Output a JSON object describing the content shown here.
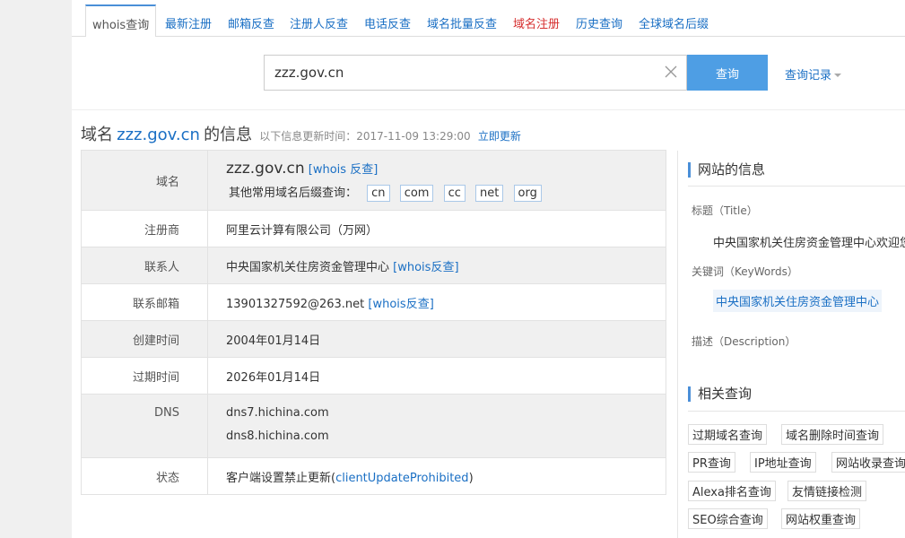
{
  "tabs": [
    {
      "label": "whois查询",
      "active": true
    },
    {
      "label": "最新注册"
    },
    {
      "label": "邮箱反查"
    },
    {
      "label": "注册人反查"
    },
    {
      "label": "电话反查"
    },
    {
      "label": "域名批量反查"
    },
    {
      "label": "域名注册",
      "color": "#d62f2f"
    },
    {
      "label": "历史查询"
    },
    {
      "label": "全球域名后缀"
    }
  ],
  "search": {
    "value": "zzz.gov.cn",
    "button_label": "查询",
    "history_label": "查询记录"
  },
  "heading": {
    "prefix": "域名",
    "domain": "zzz.gov.cn",
    "suffix": "的信息",
    "updated_text": "以下信息更新时间：2017-11-09 13:29:00",
    "update_link": "立即更新"
  },
  "info": {
    "domain": {
      "label": "域名",
      "value": "zzz.gov.cn",
      "whois_link": "[whois 反查]",
      "suffix_label": "其他常用域名后缀查询：",
      "suffixes": [
        "cn",
        "com",
        "cc",
        "net",
        "org"
      ]
    },
    "registrar": {
      "label": "注册商",
      "value": "阿里云计算有限公司（万网）"
    },
    "contact": {
      "label": "联系人",
      "value": "中央国家机关住房资金管理中心",
      "link": "[whois反查]"
    },
    "email": {
      "label": "联系邮箱",
      "value": "13901327592@263.net",
      "link": "[whois反查]"
    },
    "created": {
      "label": "创建时间",
      "value": "2004年01月14日"
    },
    "expires": {
      "label": "过期时间",
      "value": "2026年01月14日"
    },
    "dns": {
      "label": "DNS",
      "values": [
        "dns7.hichina.com",
        "dns8.hichina.com"
      ]
    },
    "status": {
      "label": "状态",
      "prefix": "客户端设置禁止更新(",
      "code": "clientUpdateProhibited",
      "suffix": ")"
    }
  },
  "site": {
    "title": "网站的信息",
    "title_label": "标题（Title）",
    "title_value": "中央国家机关住房资金管理中心欢迎您",
    "keywords_label": "关键词（KeyWords）",
    "keywords_value": "中央国家机关住房资金管理中心",
    "description_label": "描述（Description）"
  },
  "related": {
    "title": "相关查询",
    "items": [
      "过期域名查询",
      "域名删除时间查询",
      "PR查询",
      "IP地址查询",
      "网站收录查询",
      "Alexa排名查询",
      "友情链接检测",
      "SEO综合查询",
      "网站权重查询"
    ]
  },
  "colors": {
    "accent": "#4e9ee4",
    "link": "#1a6fc4",
    "red_tab": "#d62f2f"
  }
}
